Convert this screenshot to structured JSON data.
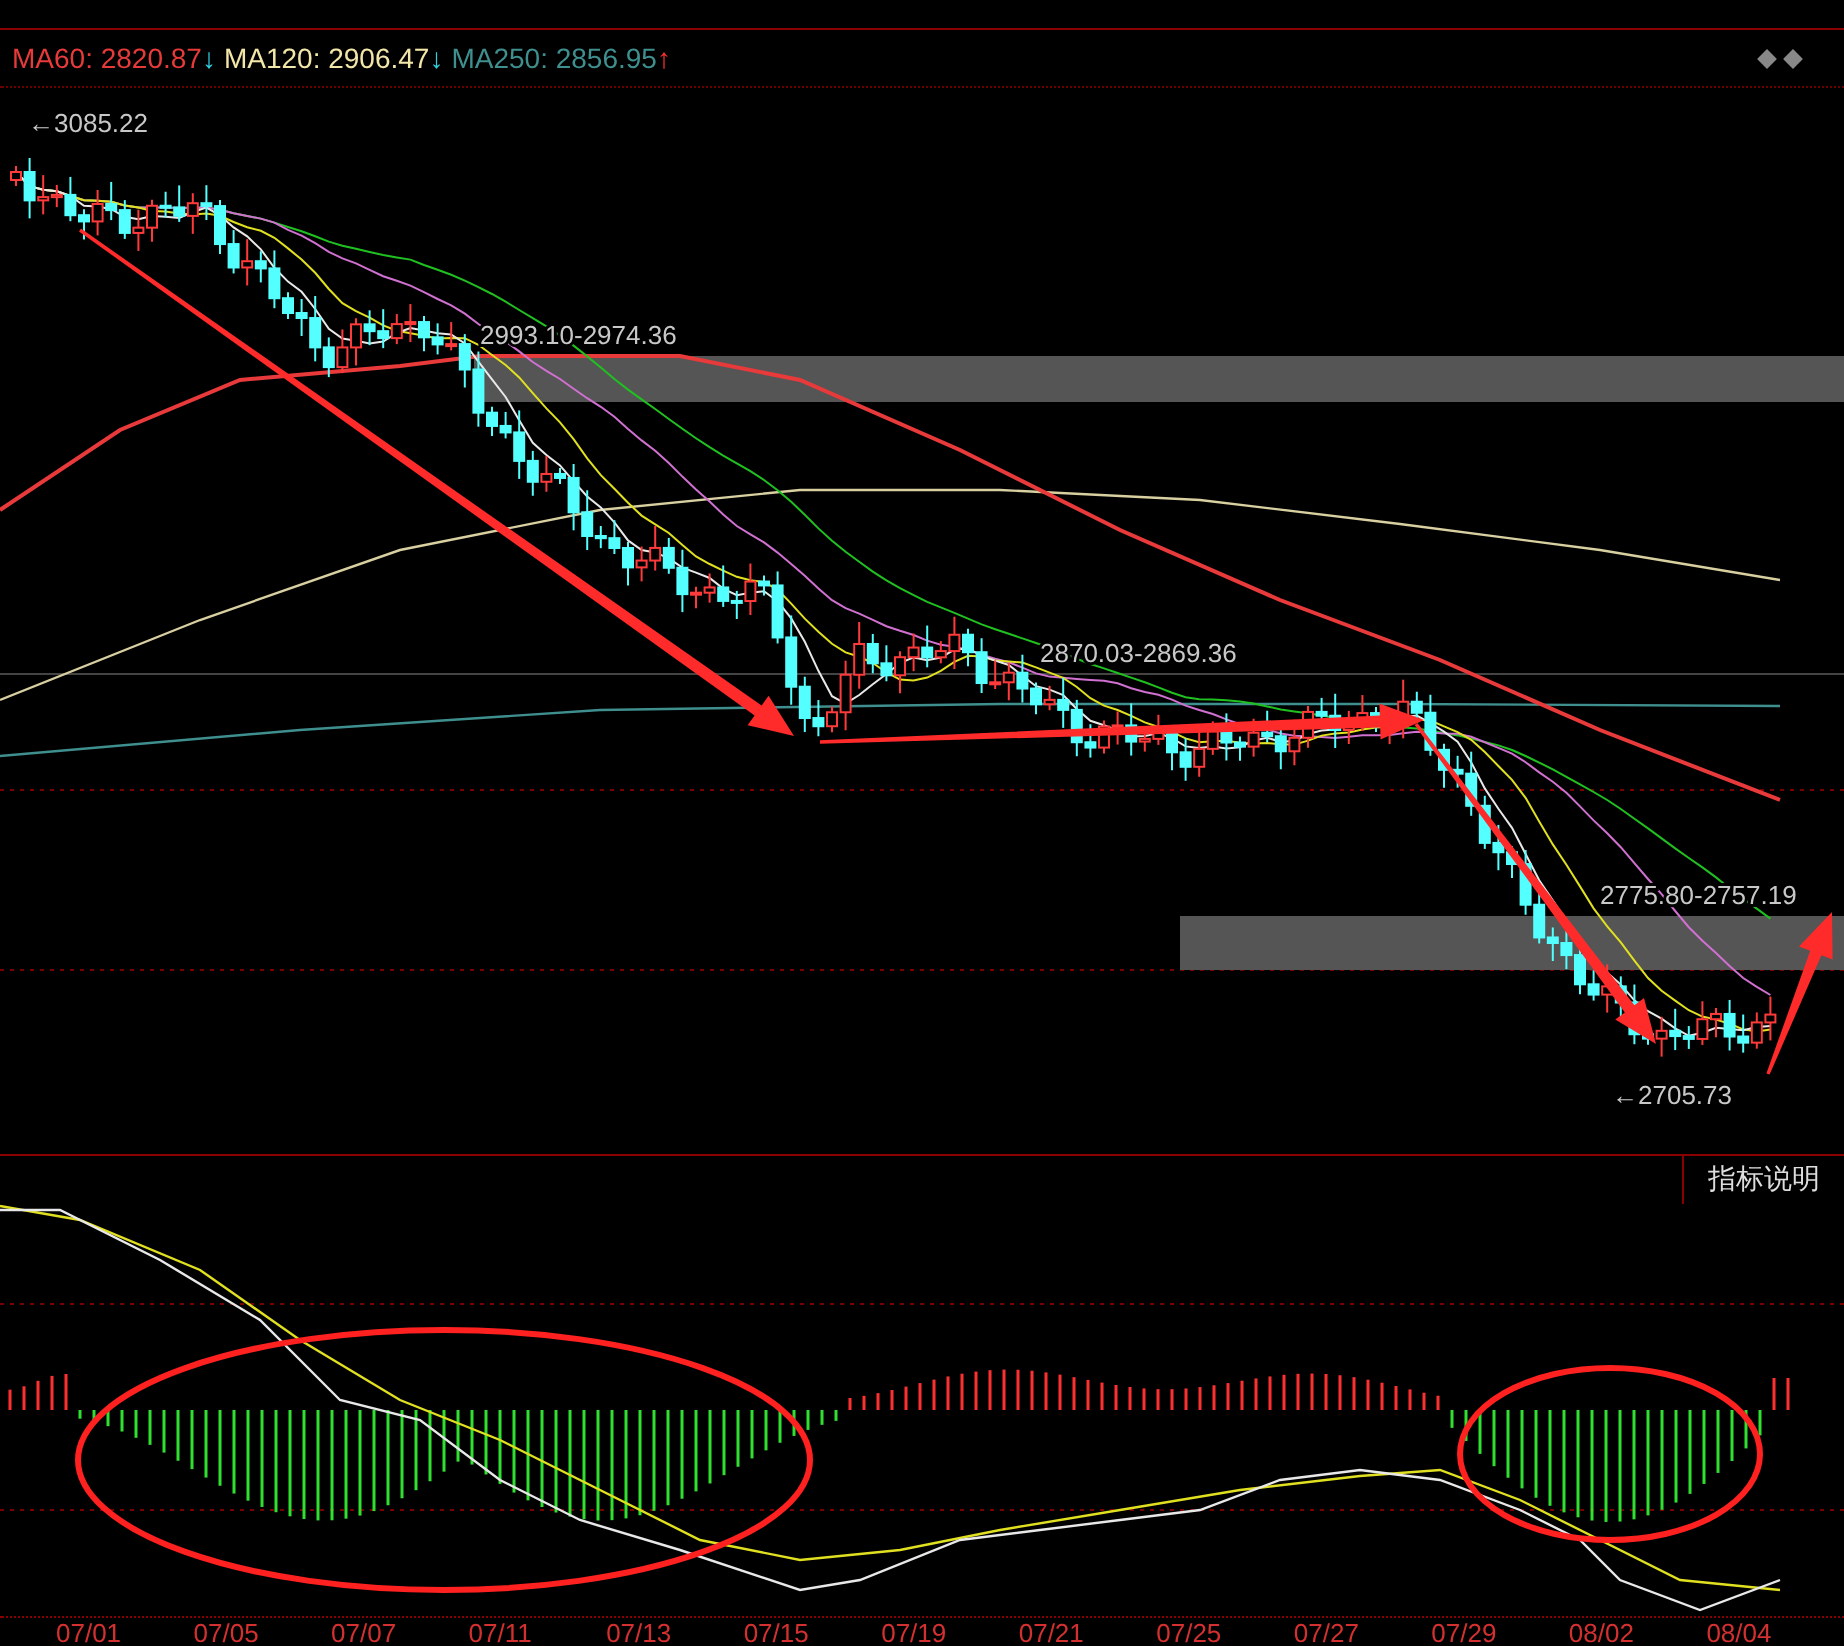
{
  "legend": [
    {
      "label": "MA60: 2820.87",
      "color": "#e83a3a",
      "arrow": {
        "text": "↓",
        "color": "#30d0e0"
      }
    },
    {
      "label": "MA120: 2906.47",
      "color": "#f2e6a8",
      "arrow": {
        "text": "↓",
        "color": "#30d0e0"
      }
    },
    {
      "label": "MA250: 2856.95",
      "color": "#3f8f8f",
      "arrow": {
        "text": "↑",
        "color": "#ff3030"
      }
    }
  ],
  "price_labels": [
    "←3085.22",
    "2993.10-2974.36",
    "2870.03-2869.36",
    "2775.80-2757.19",
    "←2705.73"
  ],
  "indicator_button": "指标说明",
  "dates": [
    "07/01",
    "07/05",
    "07/07",
    "07/11",
    "07/13",
    "07/15",
    "07/19",
    "07/21",
    "07/25",
    "07/27",
    "07/29",
    "08/02",
    "08/04"
  ]
}
